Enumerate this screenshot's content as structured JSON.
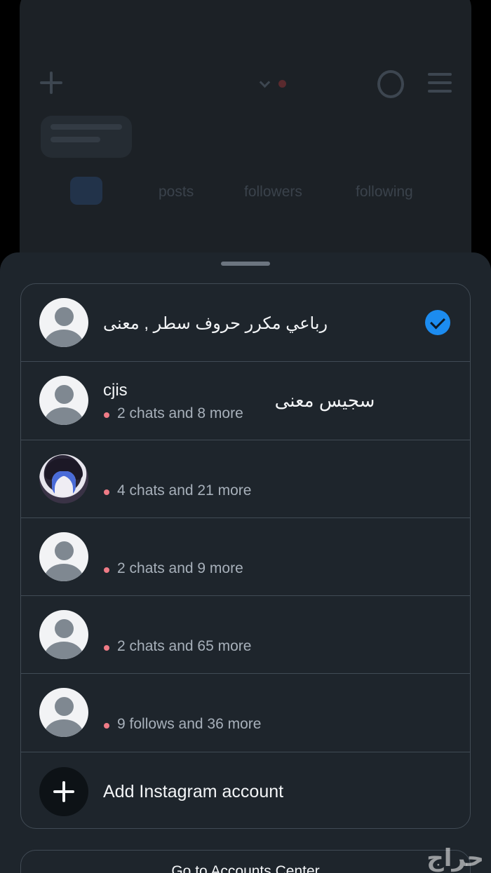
{
  "background_profile": {
    "stats": [
      "posts",
      "followers",
      "following"
    ]
  },
  "accounts": [
    {
      "name": "رباعي مكرر حروف سطر , معنى",
      "subtitle": "",
      "avatar": "default-avatar",
      "selected": true
    },
    {
      "name": "cjis",
      "subtitle": "2 chats and 8 more",
      "avatar": "default-avatar",
      "selected": false,
      "overlay_text": "سجيس معنى"
    },
    {
      "name": "",
      "subtitle": "4 chats and 21 more",
      "avatar": "photo-avatar",
      "selected": false
    },
    {
      "name": "",
      "subtitle": "2 chats and 9 more",
      "avatar": "default-avatar",
      "selected": false
    },
    {
      "name": "",
      "subtitle": "2 chats and 65 more",
      "avatar": "default-avatar",
      "selected": false
    },
    {
      "name": "",
      "subtitle": "9 follows and 36 more",
      "avatar": "default-avatar",
      "selected": false
    }
  ],
  "add_account_label": "Add Instagram account",
  "accounts_center_label": "Go to Accounts Center",
  "watermark": "حراج",
  "colors": {
    "sheet_bg": "#1e252c",
    "border": "#414b55",
    "check_blue": "#1c8cf0",
    "notification_dot": "#ef7b86"
  }
}
